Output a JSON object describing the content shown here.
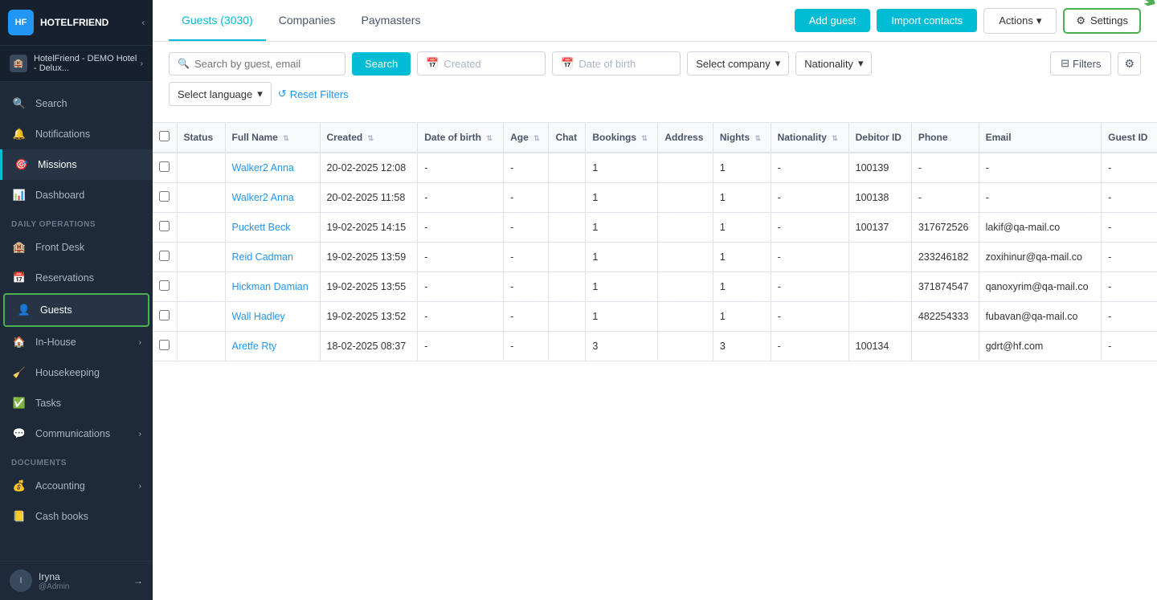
{
  "sidebar": {
    "logo": "HOTELFRIEND",
    "hotel_name": "HotelFriend - DEMO Hotel - Delux...",
    "nav_items": [
      {
        "id": "search",
        "label": "Search",
        "icon": "🔍"
      },
      {
        "id": "notifications",
        "label": "Notifications",
        "icon": "🔔"
      },
      {
        "id": "missions",
        "label": "Missions",
        "icon": "🎯"
      },
      {
        "id": "dashboard",
        "label": "Dashboard",
        "icon": "📊"
      },
      {
        "id": "front-desk",
        "label": "Front Desk",
        "icon": "🏨"
      },
      {
        "id": "reservations",
        "label": "Reservations",
        "icon": "📅"
      },
      {
        "id": "guests",
        "label": "Guests",
        "icon": "👤",
        "active": true
      },
      {
        "id": "in-house",
        "label": "In-House",
        "icon": "🏠",
        "has_arrow": true
      },
      {
        "id": "housekeeping",
        "label": "Housekeeping",
        "icon": "🧹"
      },
      {
        "id": "tasks",
        "label": "Tasks",
        "icon": "✅"
      },
      {
        "id": "communications",
        "label": "Communications",
        "icon": "💬",
        "has_arrow": true
      },
      {
        "id": "accounting",
        "label": "Accounting",
        "icon": "💰",
        "has_arrow": true
      },
      {
        "id": "cash-books",
        "label": "Cash books",
        "icon": "📒"
      }
    ],
    "sections": [
      {
        "label": "DAILY OPERATIONS",
        "after": "dashboard"
      },
      {
        "label": "DOCUMENTS",
        "after": "communications"
      }
    ],
    "footer": {
      "name": "Iryna",
      "role": "@Admin"
    }
  },
  "header": {
    "tabs": [
      {
        "id": "guests",
        "label": "Guests (3030)",
        "active": true
      },
      {
        "id": "companies",
        "label": "Companies"
      },
      {
        "id": "paymasters",
        "label": "Paymasters"
      }
    ],
    "buttons": {
      "add_guest": "Add guest",
      "import_contacts": "Import contacts",
      "actions": "Actions",
      "settings": "Settings"
    }
  },
  "filters": {
    "search_placeholder": "Search by guest, email",
    "search_btn": "Search",
    "created_placeholder": "Created",
    "dob_placeholder": "Date of birth",
    "select_company": "Select company",
    "nationality": "Nationality",
    "filters_btn": "Filters",
    "select_language": "Select language",
    "reset_filters": "Reset Filters"
  },
  "table": {
    "columns": [
      {
        "id": "status",
        "label": "Status"
      },
      {
        "id": "full_name",
        "label": "Full Name",
        "sortable": true
      },
      {
        "id": "created",
        "label": "Created",
        "sortable": true
      },
      {
        "id": "dob",
        "label": "Date of birth",
        "sortable": true
      },
      {
        "id": "age",
        "label": "Age",
        "sortable": true
      },
      {
        "id": "chat",
        "label": "Chat"
      },
      {
        "id": "bookings",
        "label": "Bookings",
        "sortable": true
      },
      {
        "id": "address",
        "label": "Address"
      },
      {
        "id": "nights",
        "label": "Nights",
        "sortable": true
      },
      {
        "id": "nationality",
        "label": "Nationality",
        "sortable": true
      },
      {
        "id": "debitor_id",
        "label": "Debitor ID"
      },
      {
        "id": "phone",
        "label": "Phone"
      },
      {
        "id": "email",
        "label": "Email"
      },
      {
        "id": "guest_id",
        "label": "Guest ID"
      }
    ],
    "rows": [
      {
        "status": "",
        "full_name": "Walker2 Anna",
        "created": "20-02-2025 12:08",
        "dob": "-",
        "age": "-",
        "chat": "",
        "bookings": "1",
        "address": "",
        "nights": "1",
        "nationality": "-",
        "debitor_id": "100139",
        "phone": "-",
        "email": "-",
        "guest_id": "-"
      },
      {
        "status": "",
        "full_name": "Walker2 Anna",
        "created": "20-02-2025 11:58",
        "dob": "-",
        "age": "-",
        "chat": "",
        "bookings": "1",
        "address": "",
        "nights": "1",
        "nationality": "-",
        "debitor_id": "100138",
        "phone": "-",
        "email": "-",
        "guest_id": "-"
      },
      {
        "status": "",
        "full_name": "Puckett Beck",
        "created": "19-02-2025 14:15",
        "dob": "-",
        "age": "-",
        "chat": "",
        "bookings": "1",
        "address": "",
        "nights": "1",
        "nationality": "-",
        "debitor_id": "100137",
        "phone": "317672526",
        "email": "lakif@qa-mail.co",
        "guest_id": "-"
      },
      {
        "status": "",
        "full_name": "Reid Cadman",
        "created": "19-02-2025 13:59",
        "dob": "-",
        "age": "-",
        "chat": "",
        "bookings": "1",
        "address": "",
        "nights": "1",
        "nationality": "-",
        "debitor_id": "",
        "phone": "233246182",
        "email": "zoxihinur@qa-mail.co",
        "guest_id": "-"
      },
      {
        "status": "",
        "full_name": "Hickman Damian",
        "created": "19-02-2025 13:55",
        "dob": "-",
        "age": "-",
        "chat": "",
        "bookings": "1",
        "address": "",
        "nights": "1",
        "nationality": "-",
        "debitor_id": "",
        "phone": "371874547",
        "email": "qanoxyrim@qa-mail.co",
        "guest_id": "-"
      },
      {
        "status": "",
        "full_name": "Wall Hadley",
        "created": "19-02-2025 13:52",
        "dob": "-",
        "age": "-",
        "chat": "",
        "bookings": "1",
        "address": "",
        "nights": "1",
        "nationality": "-",
        "debitor_id": "",
        "phone": "482254333",
        "email": "fubavan@qa-mail.co",
        "guest_id": "-"
      },
      {
        "status": "",
        "full_name": "Aretfe Rty",
        "created": "18-02-2025 08:37",
        "dob": "-",
        "age": "-",
        "chat": "",
        "bookings": "3",
        "address": "",
        "nights": "3",
        "nationality": "-",
        "debitor_id": "100134",
        "phone": "",
        "email": "gdrt@hf.com",
        "guest_id": "-"
      }
    ]
  },
  "colors": {
    "accent": "#00bcd4",
    "green": "#4caf50",
    "sidebar_bg": "#1e2a3a",
    "active_border": "#00bcd4"
  }
}
